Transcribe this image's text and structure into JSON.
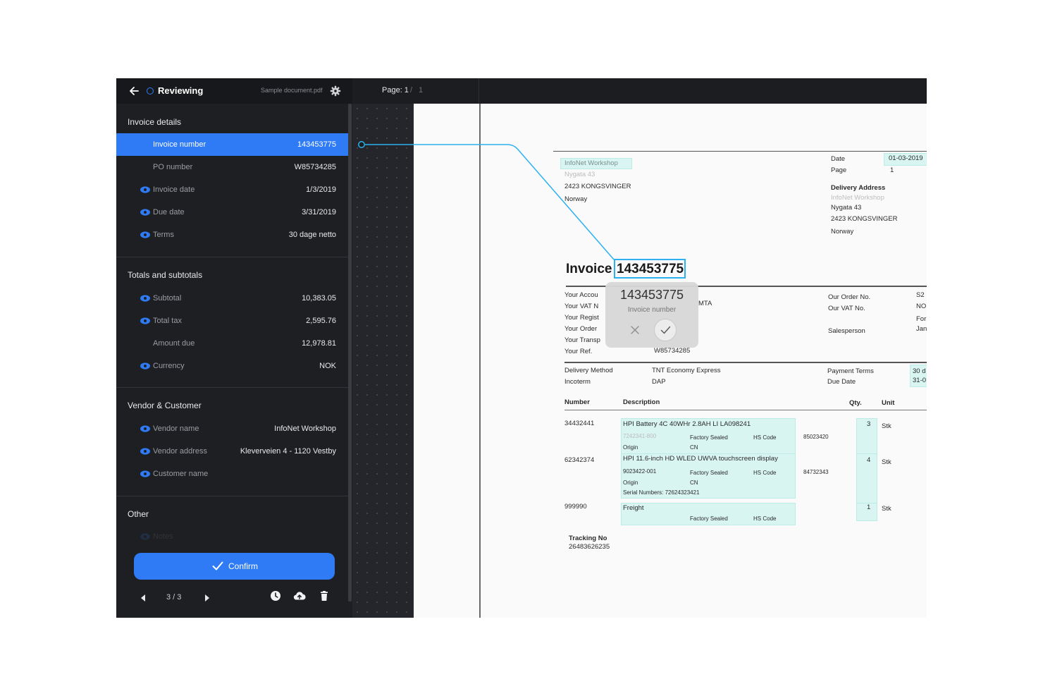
{
  "header": {
    "title": "Reviewing",
    "filename": "Sample document.pdf"
  },
  "sections": {
    "invoice_details": {
      "title": "Invoice details",
      "rows": [
        {
          "label": "Invoice number",
          "value": "143453775"
        },
        {
          "label": "PO number",
          "value": "W85734285"
        },
        {
          "label": "Invoice date",
          "value": "1/3/2019"
        },
        {
          "label": "Due date",
          "value": "3/31/2019"
        },
        {
          "label": "Terms",
          "value": "30 dage netto"
        }
      ]
    },
    "totals": {
      "title": "Totals and subtotals",
      "rows": [
        {
          "label": "Subtotal",
          "value": "10,383.05"
        },
        {
          "label": "Total tax",
          "value": "2,595.76"
        },
        {
          "label": "Amount due",
          "value": "12,978.81"
        },
        {
          "label": "Currency",
          "value": "NOK"
        }
      ]
    },
    "vendor_customer": {
      "title": "Vendor & Customer",
      "rows": [
        {
          "label": "Vendor name",
          "value": "InfoNet Workshop"
        },
        {
          "label": "Vendor address",
          "value": "Kleverveien 4 - 1120 Vestby"
        },
        {
          "label": "Customer name",
          "value": ""
        }
      ]
    },
    "other": {
      "title": "Other",
      "rows": [
        {
          "label": "Notes",
          "value": ""
        }
      ]
    }
  },
  "confirm_label": "Confirm",
  "pager": {
    "text": "3 / 3"
  },
  "viewer": {
    "page_label": "Page: 1",
    "separator": "/",
    "page_total": "1"
  },
  "accent_color": "#2f7bf5",
  "highlight_color": "#2bb1f0",
  "popup": {
    "value": "143453775",
    "label": "Invoice number"
  },
  "document": {
    "sender": {
      "name": "InfoNet Workshop",
      "street": "Nygata 43",
      "city": "2423 KONGSVINGER",
      "country": "Norway"
    },
    "meta": {
      "date_label": "Date",
      "date_value": "01-03-2019",
      "page_label": "Page",
      "page_value": "1"
    },
    "delivery": {
      "title": "Delivery Address",
      "name": "InfoNet Workshop",
      "street": "Nygata 43",
      "city": "2423 KONGSVINGER",
      "country": "Norway"
    },
    "invoice_word": "Invoice",
    "invoice_number": "143453775",
    "refs_left": [
      "Your Accou",
      "Your VAT N",
      "Your Regist",
      "Your Order",
      "Your Transp",
      "Your Ref."
    ],
    "ref_fragment": "MTA",
    "ref_value": "W85734285",
    "refs_right": [
      "Our Order No.",
      "Our VAT No.",
      "Salesperson"
    ],
    "refs_right_values": [
      "S2",
      "NO",
      "For",
      "Jan"
    ],
    "delivery_method_label": "Delivery Method",
    "delivery_method_value": "TNT Economy Express",
    "incoterm_label": "Incoterm",
    "incoterm_value": "DAP",
    "payment_terms_label": "Payment Terms",
    "due_date_label": "Due Date",
    "payment_terms_value": "30 d",
    "due_date_value": "31-0",
    "table_headers": {
      "number": "Number",
      "description": "Description",
      "qty": "Qty.",
      "unit": "Unit"
    },
    "lines": [
      {
        "number": "34432441",
        "desc": "HPI Battery 4C 40WHr 2.8AH LI LA098241",
        "part": "7242341-800",
        "sealed": "Factory Sealed",
        "hs": "HS Code",
        "hs_value": "85023420",
        "origin": "Origin",
        "origin_value": "CN",
        "qty": "3",
        "unit": "Stk"
      },
      {
        "number": "62342374",
        "desc": "HPI 11.6-inch HD WLED UWVA touchscreen display",
        "part": "9023422-001",
        "sealed": "Factory Sealed",
        "hs": "HS Code",
        "hs_value": "84732343",
        "origin": "Origin",
        "origin_value": "CN",
        "serial": "Serial Numbers:  72624323421",
        "qty": "4",
        "unit": "Stk"
      },
      {
        "number": "999990",
        "desc": "Freight",
        "sealed": "Factory Sealed",
        "hs": "HS Code",
        "qty": "1",
        "unit": "Stk"
      }
    ],
    "tracking_label": "Tracking No",
    "tracking_value": "26483626235"
  }
}
